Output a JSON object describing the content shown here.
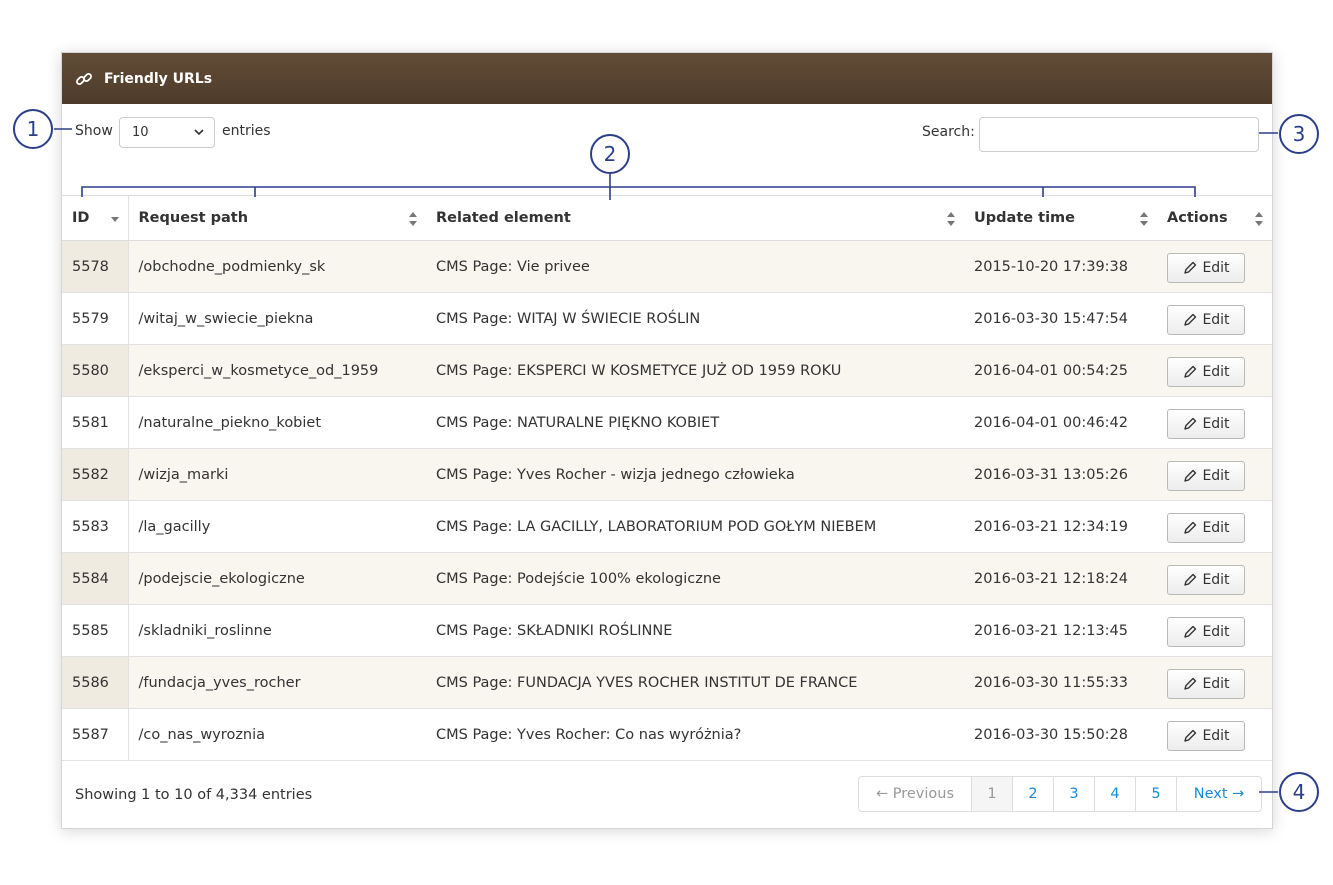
{
  "panel": {
    "title": "Friendly URLs"
  },
  "length": {
    "show_label": "Show",
    "selected": "10",
    "entries_label": "entries"
  },
  "search": {
    "label": "Search:",
    "value": "",
    "placeholder": ""
  },
  "columns": {
    "id": "ID",
    "path": "Request path",
    "element": "Related element",
    "updated": "Update time",
    "actions": "Actions"
  },
  "edit_label": "Edit",
  "rows": [
    {
      "id": "5578",
      "path": "/obchodne_podmienky_sk",
      "element": "CMS Page: Vie privee",
      "updated": "2015-10-20 17:39:38"
    },
    {
      "id": "5579",
      "path": "/witaj_w_swiecie_piekna",
      "element": "CMS Page: WITAJ W ŚWIECIE ROŚLIN",
      "updated": "2016-03-30 15:47:54"
    },
    {
      "id": "5580",
      "path": "/eksperci_w_kosmetyce_od_1959",
      "element": "CMS Page: EKSPERCI W KOSMETYCE JUŻ OD 1959 ROKU",
      "updated": "2016-04-01 00:54:25"
    },
    {
      "id": "5581",
      "path": "/naturalne_piekno_kobiet",
      "element": "CMS Page: NATURALNE PIĘKNO KOBIET",
      "updated": "2016-04-01 00:46:42"
    },
    {
      "id": "5582",
      "path": "/wizja_marki",
      "element": "CMS Page: Yves Rocher - wizja jednego człowieka",
      "updated": "2016-03-31 13:05:26"
    },
    {
      "id": "5583",
      "path": "/la_gacilly",
      "element": "CMS Page: LA GACILLY, LABORATORIUM POD GOŁYM NIEBEM",
      "updated": "2016-03-21 12:34:19"
    },
    {
      "id": "5584",
      "path": "/podejscie_ekologiczne",
      "element": "CMS Page: Podejście 100% ekologiczne",
      "updated": "2016-03-21 12:18:24"
    },
    {
      "id": "5585",
      "path": "/skladniki_roslinne",
      "element": "CMS Page: SKŁADNIKI ROŚLINNE",
      "updated": "2016-03-21 12:13:45"
    },
    {
      "id": "5586",
      "path": "/fundacja_yves_rocher",
      "element": "CMS Page: FUNDACJA YVES ROCHER INSTITUT DE FRANCE",
      "updated": "2016-03-30 11:55:33"
    },
    {
      "id": "5587",
      "path": "/co_nas_wyroznia",
      "element": "CMS Page: Yves Rocher: Co nas wyróżnia?",
      "updated": "2016-03-30 15:50:28"
    }
  ],
  "footer": {
    "info": "Showing 1 to 10 of 4,334 entries"
  },
  "pagination": {
    "previous": "← Previous",
    "pages": [
      "1",
      "2",
      "3",
      "4",
      "5"
    ],
    "current": "1",
    "next": "Next →"
  },
  "callouts": [
    "1",
    "2",
    "3",
    "4"
  ],
  "colors": {
    "header": "#5b4632",
    "accent": "#2c3e8a",
    "link": "#1a8ad4"
  },
  "icons": {
    "header": "link-icon",
    "edit": "pencil-icon",
    "sort": "sort-icon",
    "select": "chevron-down-icon"
  }
}
